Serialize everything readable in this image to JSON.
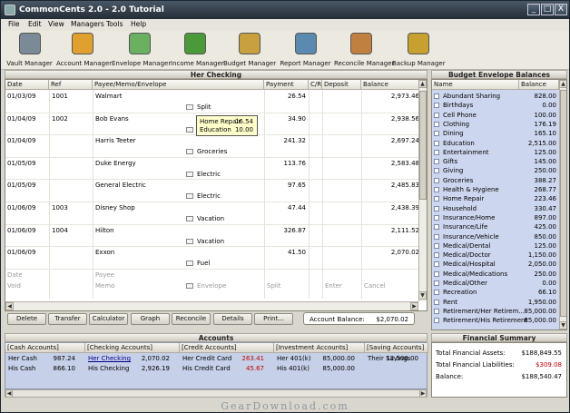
{
  "window": {
    "title": "CommonCents 2.0 - 2.0 Tutorial",
    "minimize": "_",
    "maximize": "□",
    "close": "X"
  },
  "menu": [
    "File",
    "Edit",
    "View",
    "Managers",
    "Tools",
    "Help"
  ],
  "toolbar": [
    {
      "label": "Vault Manager",
      "icon": "vault-icon",
      "color": "#7a8a96"
    },
    {
      "label": "Account Manager",
      "icon": "account-icon",
      "color": "#e0a030"
    },
    {
      "label": "Envelope Manager",
      "icon": "envelope-icon",
      "color": "#6ab060"
    },
    {
      "label": "Income Manager",
      "icon": "money-icon",
      "color": "#4a9a3a"
    },
    {
      "label": "Budget Manager",
      "icon": "moneybag-icon",
      "color": "#c8a040"
    },
    {
      "label": "Report Manager",
      "icon": "report-icon",
      "color": "#5a8ab0"
    },
    {
      "label": "Reconcile Manager",
      "icon": "reconcile-icon",
      "color": "#c08040"
    },
    {
      "label": "Backup Manager",
      "icon": "backup-icon",
      "color": "#c8a030"
    }
  ],
  "register": {
    "title": "Her Checking",
    "columns": [
      "Date",
      "Ref",
      "Payee/Memo/Envelope",
      "Payment",
      "C/R",
      "Deposit",
      "Balance"
    ],
    "rows": [
      {
        "date": "01/03/09",
        "ref": "1001",
        "payee": "Walmart",
        "payment": "26.54",
        "balance": "2,973.46",
        "envelope": "Split"
      },
      {
        "date": "01/04/09",
        "ref": "1002",
        "payee": "Bob Evans",
        "payment": "34.90",
        "balance": "2,938.56",
        "envelope": ""
      },
      {
        "date": "01/04/09",
        "ref": "",
        "payee": "Harris Teeter",
        "payment": "241.32",
        "balance": "2,697.24",
        "envelope": "Groceries"
      },
      {
        "date": "01/05/09",
        "ref": "",
        "payee": "Duke Energy",
        "payment": "113.76",
        "balance": "2,583.48",
        "envelope": "Electric"
      },
      {
        "date": "01/05/09",
        "ref": "",
        "payee": "General Electric",
        "payment": "97.65",
        "balance": "2,485.83",
        "envelope": "Electric"
      },
      {
        "date": "01/06/09",
        "ref": "1003",
        "payee": "Disney Shop",
        "payment": "47.44",
        "balance": "2,438.39",
        "envelope": "Vacation"
      },
      {
        "date": "01/06/09",
        "ref": "1004",
        "payee": "Hilton",
        "payment": "326.87",
        "balance": "2,111.52",
        "envelope": "Vacation"
      },
      {
        "date": "01/06/09",
        "ref": "",
        "payee": "Exxon",
        "payment": "41.50",
        "balance": "2,070.02",
        "envelope": "Fuel"
      }
    ],
    "new_row": {
      "date": "Date",
      "payee": "Payee",
      "void": "Void",
      "memo": "Memo",
      "envelope": "Envelope",
      "split": "Split",
      "enter": "Enter",
      "cancel": "Cancel"
    },
    "tooltip": [
      {
        "name": "Home Repair",
        "value": "16.54"
      },
      {
        "name": "Education",
        "value": "10.00"
      }
    ]
  },
  "buttons": [
    "Delete",
    "Transfer",
    "Calculator",
    "Graph",
    "Reconcile",
    "Details",
    "Print..."
  ],
  "account_balance": {
    "label": "Account Balance:",
    "value": "$2,070.02"
  },
  "envelopes": {
    "title": "Budget Envelope Balances",
    "col_name": "Name",
    "col_balance": "Balance",
    "items": [
      [
        "Abundant Sharing",
        "828.00"
      ],
      [
        "Birthdays",
        "0.00"
      ],
      [
        "Cell Phone",
        "100.00"
      ],
      [
        "Clothing",
        "176.19"
      ],
      [
        "Dining",
        "165.10"
      ],
      [
        "Education",
        "2,515.00"
      ],
      [
        "Entertainment",
        "125.00"
      ],
      [
        "Gifts",
        "145.00"
      ],
      [
        "Giving",
        "250.00"
      ],
      [
        "Groceries",
        "388.27"
      ],
      [
        "Health & Hygiene",
        "268.77"
      ],
      [
        "Home Repair",
        "223.46"
      ],
      [
        "Household",
        "330.47"
      ],
      [
        "Insurance/Home",
        "897.00"
      ],
      [
        "Insurance/Life",
        "425.00"
      ],
      [
        "Insurance/Vehicle",
        "850.00"
      ],
      [
        "Medical/Dental",
        "125.00"
      ],
      [
        "Medical/Doctor",
        "1,150.00"
      ],
      [
        "Medical/Hospital",
        "2,050.00"
      ],
      [
        "Medical/Medications",
        "250.00"
      ],
      [
        "Medical/Other",
        "0.00"
      ],
      [
        "Recreation",
        "66.10"
      ],
      [
        "Rent",
        "1,950.00"
      ],
      [
        "Retirement/Her Retirem...",
        "85,000.00"
      ],
      [
        "Retirement/His Retirement",
        "85,000.00"
      ]
    ]
  },
  "accounts": {
    "title": "Accounts",
    "groups": [
      {
        "header": "[Cash Accounts]",
        "items": [
          [
            "Her Cash",
            "987.24"
          ],
          [
            "His Cash",
            "866.10"
          ]
        ]
      },
      {
        "header": "[Checking Accounts]",
        "items": [
          [
            "Her Checking",
            "2,070.02"
          ],
          [
            "His Checking",
            "2,926.19"
          ]
        ]
      },
      {
        "header": "[Credit Accounts]",
        "items": [
          [
            "Her Credit Card",
            "263.41"
          ],
          [
            "His Credit Card",
            "45.67"
          ]
        ]
      },
      {
        "header": "[Investment Accounts]",
        "items": [
          [
            "Her 401(k)",
            "85,000.00"
          ],
          [
            "His 401(k)",
            "85,000.00"
          ]
        ]
      },
      {
        "header": "[Saving Accounts]",
        "items": [
          [
            "Their Savings",
            "12,500.00"
          ]
        ]
      }
    ]
  },
  "financial": {
    "title": "Financial Summary",
    "assets_label": "Total Financial Assets:",
    "assets": "$188,849.55",
    "liab_label": "Total Financial Liabilities:",
    "liab": "$309.08",
    "bal_label": "Balance:",
    "bal": "$188,540.47"
  },
  "colors": {
    "negative": "#c00000",
    "link": "#00008b"
  },
  "watermark": "GearDownload.com"
}
